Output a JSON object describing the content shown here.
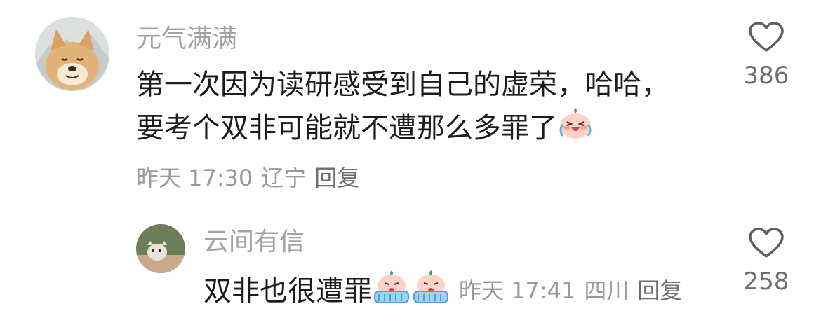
{
  "comments": [
    {
      "username": "元气满满",
      "text_line1": "第一次因为读研感受到自己的虚荣，哈哈，",
      "text_line2": "要考个双非可能就不遭那么多罪了",
      "time": "昨天 17:30",
      "location": "辽宁",
      "reply_label": "回复",
      "likes": "386",
      "emoji": "laughing-crying-peach-emoji"
    },
    {
      "username": "云间有信",
      "text": "双非也很遭罪",
      "time": "昨天 17:41",
      "location": "四川",
      "reply_label": "回复",
      "likes": "258",
      "emoji": "crying-peach-emoji"
    }
  ],
  "colors": {
    "username": "#a2a2a2",
    "text": "#1c1c1c",
    "meta": "#9a9a9a",
    "icon": "#5f5f5f"
  }
}
